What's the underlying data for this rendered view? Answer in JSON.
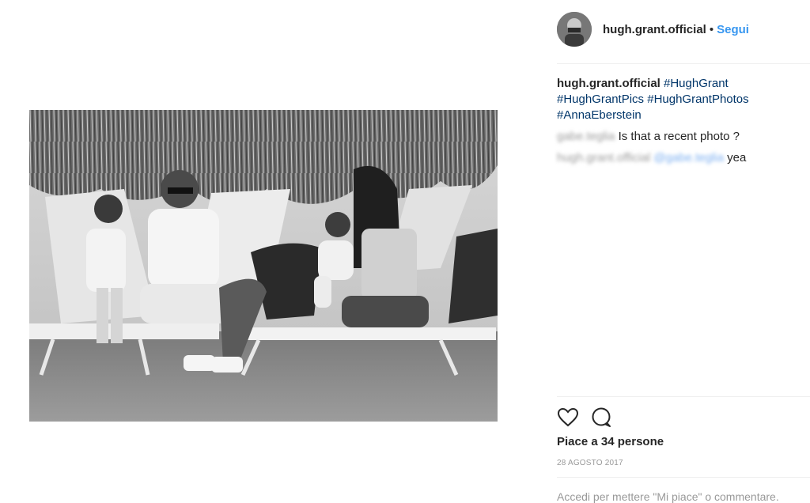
{
  "post": {
    "username": "hugh.grant.official",
    "follow_label": "Segui",
    "separator": "•",
    "photo_alt": "Black and white beach photo"
  },
  "caption": {
    "username": "hugh.grant.official",
    "hashtags": [
      "#HughGrant",
      "#HughGrantPics",
      "#HughGrantPhotos",
      "#AnnaEberstein"
    ]
  },
  "comments": [
    {
      "user_blurred": "gabe.teglia",
      "text": "Is that a recent photo ?"
    },
    {
      "user_blurred": "hugh.grant.official",
      "mention_blurred": "@gabe.teglia",
      "text": "yea"
    }
  ],
  "actions": {
    "like_icon": "heart-icon",
    "comment_icon": "comment-icon"
  },
  "likes_text": "Piace a 34 persone",
  "date_text": "28 AGOSTO 2017",
  "login_text": "Accedi per mettere \"Mi piace\" o commentare."
}
